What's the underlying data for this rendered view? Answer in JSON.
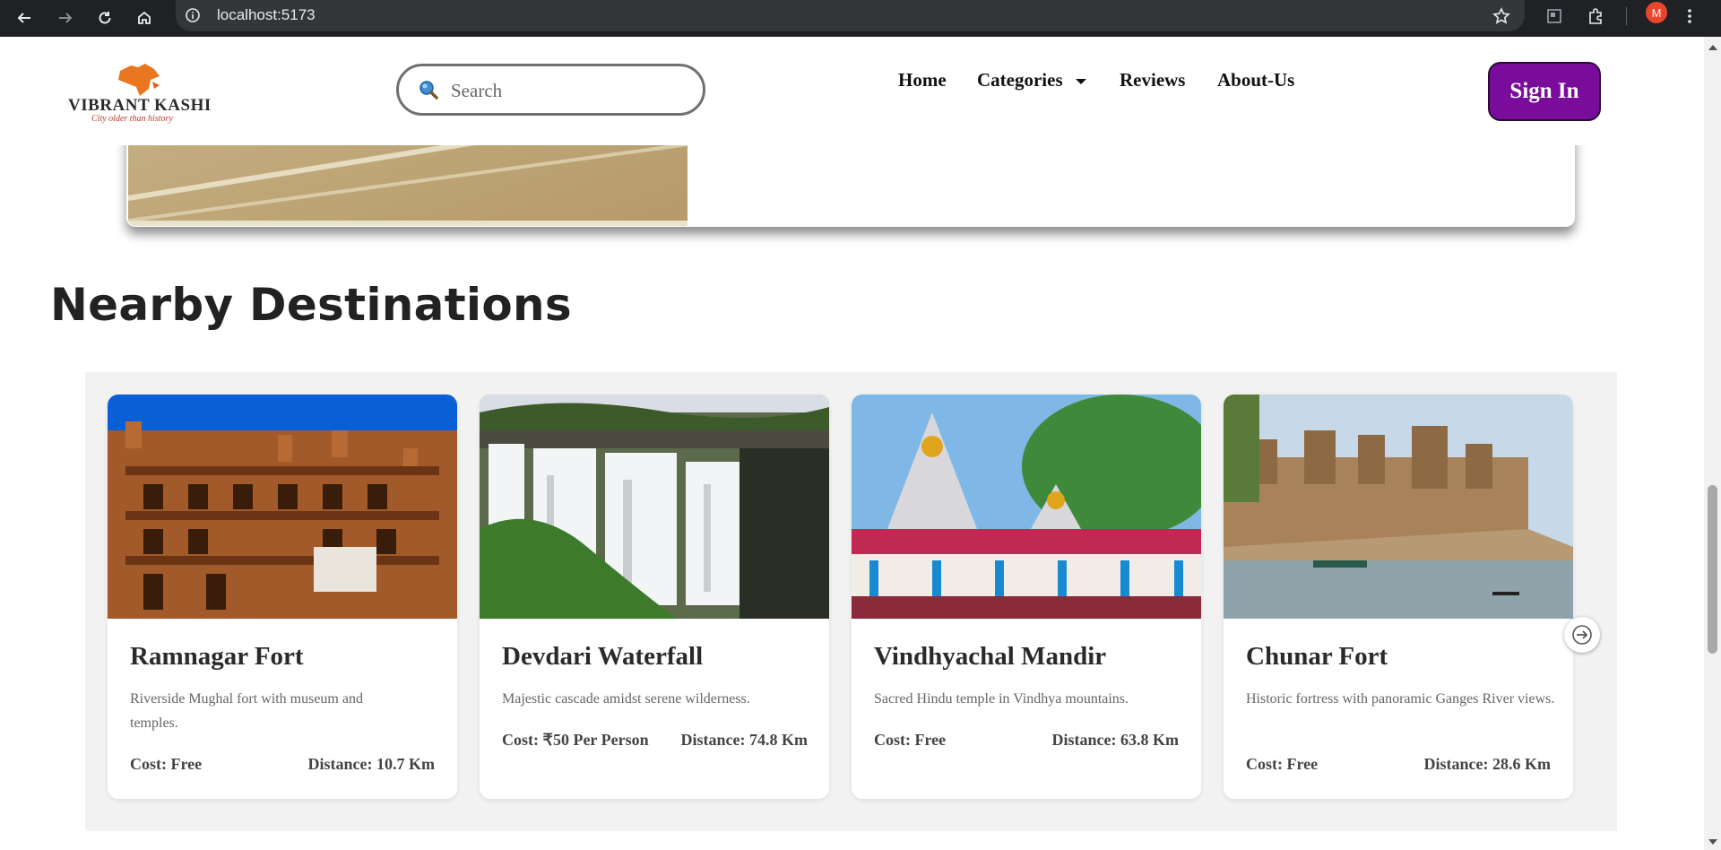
{
  "browser": {
    "url": "localhost:5173",
    "profile_initial": "M"
  },
  "header": {
    "logo_title": "VIBRANT KASHI",
    "logo_tagline": "City older than history",
    "search_placeholder": "Search",
    "nav": {
      "home": "Home",
      "categories": "Categories",
      "reviews": "Reviews",
      "about": "About-Us"
    },
    "sign_in": "Sign In"
  },
  "section": {
    "title": "Nearby Destinations"
  },
  "cards": [
    {
      "title": "Ramnagar Fort",
      "description": "Riverside Mughal fort with museum and temples.",
      "cost": "Cost: Free",
      "distance": "Distance: 10.7 Km"
    },
    {
      "title": "Devdari Waterfall",
      "description": "Majestic cascade amidst serene wilderness.",
      "cost": "Cost: ₹50 Per Person",
      "distance": "Distance: 74.8 Km"
    },
    {
      "title": "Vindhyachal Mandir",
      "description": "Sacred Hindu temple in Vindhya mountains.",
      "cost": "Cost: Free",
      "distance": "Distance: 63.8 Km"
    },
    {
      "title": "Chunar Fort",
      "description": "Historic fortress with panoramic Ganges River views.",
      "cost": "Cost: Free",
      "distance": "Distance: 28.6 Km"
    }
  ],
  "colors": {
    "sign_in_bg": "#7a0c9c",
    "carousel_bg": "#f2f2f2"
  },
  "icons": {
    "back": "arrow-left-icon",
    "forward": "arrow-right-icon",
    "reload": "reload-icon",
    "home": "home-icon",
    "bookmark": "star-icon",
    "search": "magnifier-icon",
    "next": "arrow-right-circle-icon"
  }
}
